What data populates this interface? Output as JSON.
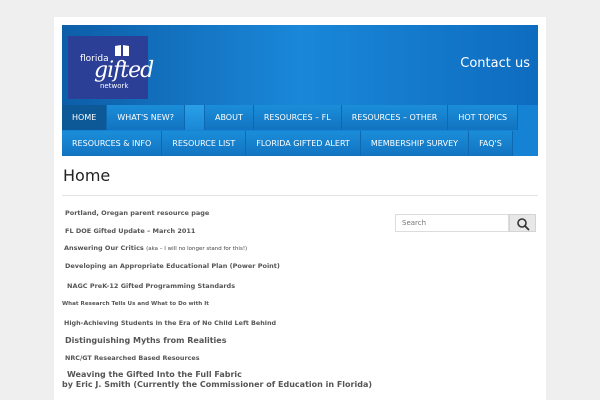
{
  "header": {
    "logo": {
      "line1": "florida",
      "line2": "gifted",
      "line3": "network"
    },
    "contact_label": "Contact us"
  },
  "nav": {
    "row1": [
      "HOME",
      "WHAT'S NEW?",
      "ABOUT",
      "RESOURCES – FL",
      "RESOURCES – OTHER",
      "HOT TOPICS"
    ],
    "row2": [
      "RESOURCES & INFO",
      "RESOURCE LIST",
      "FLORIDA GIFTED ALERT",
      "MEMBERSHIP SURVEY",
      "FAQ'S"
    ],
    "active": "HOME"
  },
  "main": {
    "title": "Home",
    "links": [
      {
        "text": "Portland, Oregan parent resource page"
      },
      {
        "text": "FL DOE Gifted Update – March 2011"
      },
      {
        "text": "Answering Our Critics",
        "note": "(aka – I will no longer stand for this!)"
      },
      {
        "text": "Developing an Appropriate Educational Plan  (Power Point)"
      },
      {
        "text": "NAGC PreK-12 Gifted Programming Standards"
      },
      {
        "text": "What Research Tells Us and What to Do with It"
      },
      {
        "text": "High-Achieving Students in the Era of No Child Left Behind"
      },
      {
        "text": "Distinguishing Myths from Realities"
      },
      {
        "text": "NRC/GT Researched Based Resources"
      },
      {
        "text": "Weaving the Gifted Into the Full Fabric"
      },
      {
        "text": "by Eric J. Smith  (Currently the Commissioner of Education in Florida)"
      }
    ]
  },
  "sidebar": {
    "search": {
      "placeholder": "Search"
    }
  },
  "colors": {
    "header_blue": "#1a87d8",
    "nav_blue": "#1582d4",
    "nav_active": "#0d5897",
    "logo_bg": "#2b3f97"
  },
  "icons": {
    "search": "magnifier-icon",
    "logo": "book-icon"
  }
}
